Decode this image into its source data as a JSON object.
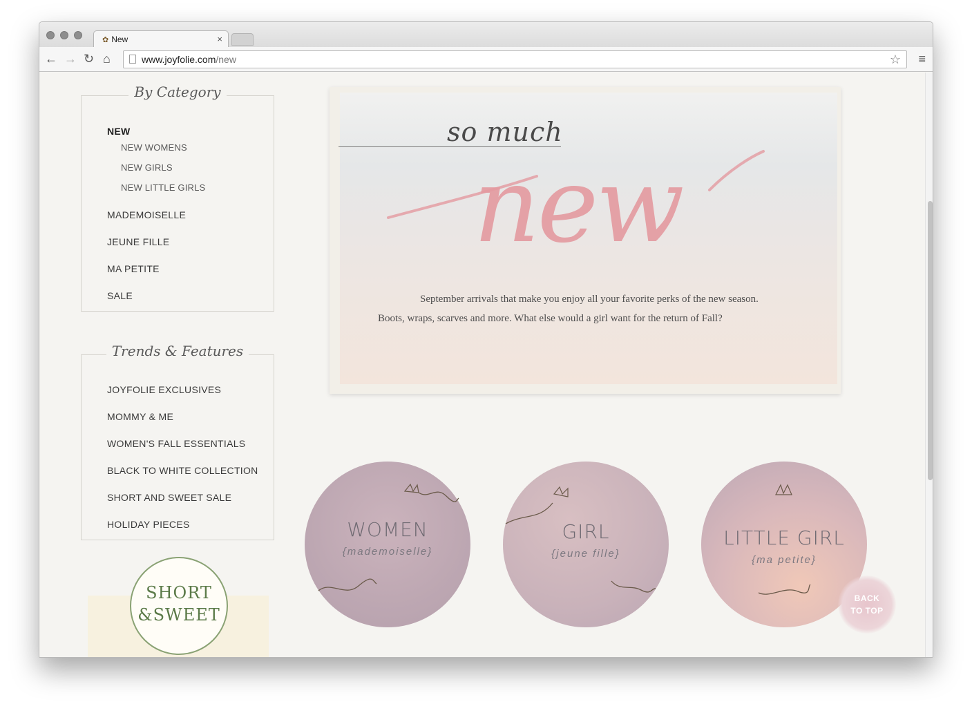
{
  "browser": {
    "tab_title": "New",
    "url_domain": "www.joyfolie.com",
    "url_path": "/new"
  },
  "sidebar": {
    "category_title": "By Category",
    "categories": [
      {
        "label": "NEW"
      },
      {
        "label": "NEW WOMENS"
      },
      {
        "label": "NEW GIRLS"
      },
      {
        "label": "NEW LITTLE GIRLS"
      },
      {
        "label": "MADEMOISELLE"
      },
      {
        "label": "JEUNE FILLE"
      },
      {
        "label": "MA PETITE"
      },
      {
        "label": "SALE"
      }
    ],
    "trends_title": "Trends & Features",
    "trends": [
      {
        "label": "JOYFOLIE EXCLUSIVES"
      },
      {
        "label": "MOMMY & ME"
      },
      {
        "label": "WOMEN'S FALL ESSENTIALS"
      },
      {
        "label": "BLACK TO WHITE COLLECTION"
      },
      {
        "label": "SHORT AND SWEET SALE"
      },
      {
        "label": "HOLIDAY PIECES"
      }
    ],
    "promo": {
      "line1": "SHORT",
      "line2": "&SWEET"
    }
  },
  "hero": {
    "heading_small": "so much",
    "heading_large": "new",
    "text_line1": "September arrivals that make you enjoy all your favorite perks of the new season.",
    "text_line2": "Boots, wraps, scarves and more. What else would a girl want for the return of Fall?"
  },
  "shop_circles": [
    {
      "title": "WOMEN",
      "subtitle": "{mademoiselle}"
    },
    {
      "title": "GIRL",
      "subtitle": "{jeune fille}"
    },
    {
      "title": "LITTLE GIRL",
      "subtitle": "{ma petite}"
    }
  ],
  "back_to_top": {
    "line1": "BACK",
    "line2": "TO TOP"
  },
  "colors": {
    "accent_pink": "#e49aa0",
    "promo_green": "#5b7a48"
  }
}
